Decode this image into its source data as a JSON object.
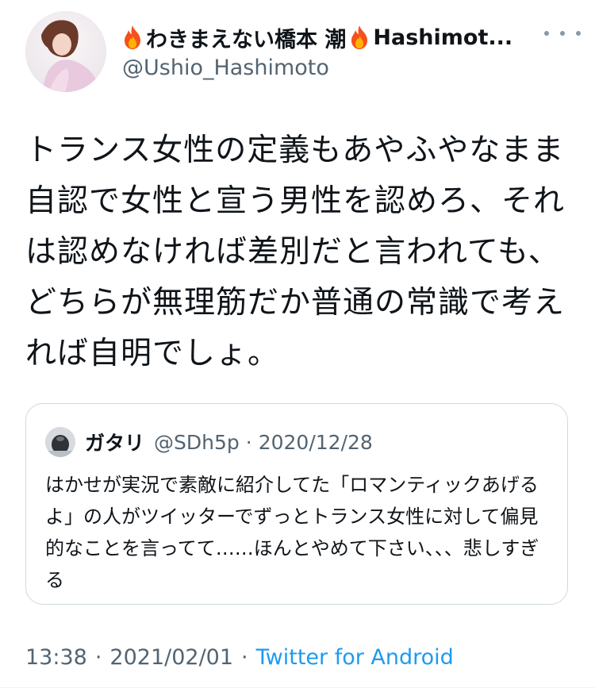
{
  "author": {
    "display_name": "わきまえない橋本 潮",
    "display_name_suffix": "Hashimot...",
    "handle": "@Ushio_Hashimoto",
    "name_emoji": "fire-icon"
  },
  "tweet": {
    "text": "トランス女性の定義もあやふやなまま自認で女性と宣う男性を認めろ、それは認めなければ差別だと言われても、どちらが無理筋だか普通の常識で考えれば自明でしょ。",
    "time": "13:38",
    "date": "2021/02/01",
    "separator": "·",
    "source": "Twitter for Android"
  },
  "quoted": {
    "display_name": "ガタリ",
    "handle": "@SDh5p",
    "separator": "·",
    "date": "2020/12/28",
    "text": "はかせが実況で素敵に紹介してた「ロマンティックあげるよ」の人がツイッターでずっとトランス女性に対して偏見的なことを言ってて……ほんとやめて下さい、、、悲しすぎる"
  },
  "colors": {
    "text": "#0f1419",
    "secondary": "#536471",
    "link": "#1d9bf0",
    "border": "#cfd9de"
  }
}
